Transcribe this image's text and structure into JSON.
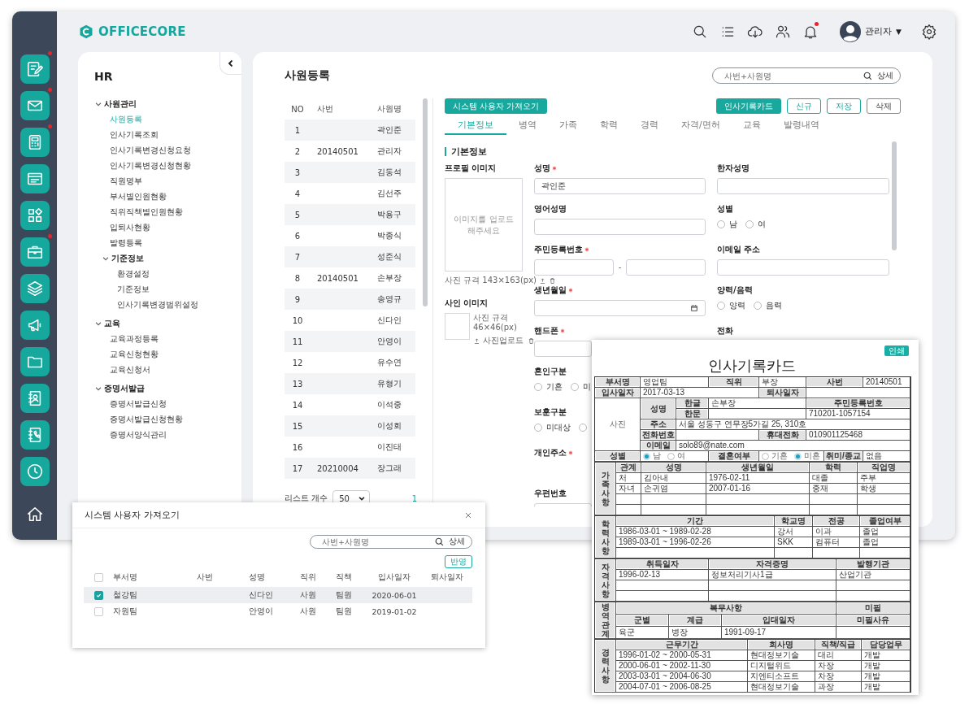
{
  "brand": {
    "name": "OFFICECORE"
  },
  "rail": {
    "items": [
      {
        "badge": true
      },
      {
        "badge": true
      },
      {
        "badge": true
      },
      {
        "badge": false
      },
      {
        "badge": false
      },
      {
        "badge": true
      },
      {
        "badge": false
      },
      {
        "badge": false
      },
      {
        "badge": false
      },
      {
        "badge": false
      },
      {
        "badge": false
      },
      {
        "badge": false
      }
    ]
  },
  "header": {
    "notification_badge": true,
    "user_name": "관리자",
    "user_caret": "▼"
  },
  "sidebar": {
    "title": "HR",
    "tree": [
      {
        "kind": "group",
        "label": "사원관리",
        "expanded": true,
        "children": [
          {
            "kind": "leaf",
            "label": "사원등록",
            "selected": true
          },
          {
            "kind": "leaf",
            "label": "인사기록조회",
            "selected": false
          },
          {
            "kind": "leaf",
            "label": "인사기록변경신청요청",
            "selected": false
          },
          {
            "kind": "leaf",
            "label": "인사기록변경신청현황",
            "selected": false
          },
          {
            "kind": "leaf",
            "label": "직원명부",
            "selected": false
          },
          {
            "kind": "leaf",
            "label": "부서별인원현황",
            "selected": false
          },
          {
            "kind": "leaf",
            "label": "직위직책별인원현황",
            "selected": false
          },
          {
            "kind": "leaf",
            "label": "입퇴사현황",
            "selected": false
          },
          {
            "kind": "leaf",
            "label": "발령등록",
            "selected": false
          },
          {
            "kind": "group",
            "label": "기준정보",
            "expanded": true,
            "children": [
              {
                "kind": "leaf",
                "label": "환경설정",
                "selected": false
              },
              {
                "kind": "leaf",
                "label": "기준정보",
                "selected": false
              },
              {
                "kind": "leaf",
                "label": "인사기록변경범위설정",
                "selected": false
              }
            ]
          }
        ]
      },
      {
        "kind": "group",
        "label": "교육",
        "expanded": true,
        "children": [
          {
            "kind": "leaf",
            "label": "교육과정등록",
            "selected": false
          },
          {
            "kind": "leaf",
            "label": "교육신청현황",
            "selected": false
          },
          {
            "kind": "leaf",
            "label": "교육신청서",
            "selected": false
          }
        ]
      },
      {
        "kind": "group",
        "label": "증명서발급",
        "expanded": true,
        "children": [
          {
            "kind": "leaf",
            "label": "증명서발급신청",
            "selected": false
          },
          {
            "kind": "leaf",
            "label": "증명서발급신청현황",
            "selected": false
          },
          {
            "kind": "leaf",
            "label": "증명서양식관리",
            "selected": false
          }
        ]
      }
    ]
  },
  "page": {
    "title": "사원등록",
    "search": {
      "placeholder": "사번+사원명",
      "detail_button": "상세"
    }
  },
  "employee_list": {
    "columns": [
      "NO",
      "사번",
      "사원명"
    ],
    "rows": [
      {
        "no": "1",
        "name": "곽인준"
      },
      {
        "no": "2",
        "id": "20140501",
        "name": "관리자"
      },
      {
        "no": "3",
        "name": "김동석"
      },
      {
        "no": "4",
        "name": "김선주"
      },
      {
        "no": "5",
        "name": "박용구"
      },
      {
        "no": "6",
        "name": "박종식"
      },
      {
        "no": "7",
        "name": "성준식"
      },
      {
        "no": "8",
        "id": "20140501",
        "name": "손부장"
      },
      {
        "no": "9",
        "name": "송영규"
      },
      {
        "no": "10",
        "name": "신다인"
      },
      {
        "no": "11",
        "name": "안영이"
      },
      {
        "no": "12",
        "name": "유수연"
      },
      {
        "no": "13",
        "name": "유형기"
      },
      {
        "no": "14",
        "name": "이석중"
      },
      {
        "no": "15",
        "name": "이성회"
      },
      {
        "no": "16",
        "name": "이진태"
      },
      {
        "no": "17",
        "id": "20210004",
        "name": "장그래"
      }
    ],
    "footer": {
      "label": "리스트 개수",
      "page_size": "50",
      "page": "1"
    }
  },
  "form": {
    "buttons": [
      {
        "label": "시스템 사용자 가져오기",
        "kind": "primary"
      },
      {
        "label": "인사기록카드",
        "kind": "primary"
      },
      {
        "label": "신규",
        "kind": "outline"
      },
      {
        "label": "저장",
        "kind": "outline"
      },
      {
        "label": "삭제",
        "kind": "plain"
      }
    ],
    "tabs": [
      {
        "label": "기본정보",
        "selected": true
      },
      {
        "label": "병역",
        "selected": false
      },
      {
        "label": "가족",
        "selected": false
      },
      {
        "label": "학력",
        "selected": false
      },
      {
        "label": "경력",
        "selected": false
      },
      {
        "label": "자격/면허",
        "selected": false
      },
      {
        "label": "교육",
        "selected": false
      },
      {
        "label": "발령내역",
        "selected": false
      }
    ],
    "section_title": "기본정보",
    "profile": {
      "label": "프로필 이미지",
      "upload_hint": "이미지를 업로드해주세요",
      "spec": "사진 규격 143×163(px)"
    },
    "sign": {
      "label": "사인 이미지",
      "spec": "사진 규격 46×46(px)",
      "upload": "사진업로드"
    },
    "fields": [
      {
        "kind": "text",
        "label": "성명",
        "required": true,
        "value": "곽인준"
      },
      {
        "kind": "text",
        "label": "한자성명",
        "required": false
      },
      {
        "kind": "text",
        "label": "영어성명",
        "required": false
      },
      {
        "kind": "radio",
        "label": "성별",
        "required": false,
        "options": [
          {
            "label": "남",
            "selected": false
          },
          {
            "label": "여",
            "selected": false
          }
        ]
      },
      {
        "kind": "split",
        "label": "주민등록번호",
        "required": true,
        "separator": "-"
      },
      {
        "kind": "text",
        "label": "이메일 주소",
        "required": false
      },
      {
        "kind": "date",
        "label": "생년월일",
        "required": true
      },
      {
        "kind": "radio",
        "label": "양력/음력",
        "required": false,
        "options": [
          {
            "label": "양력",
            "selected": false
          },
          {
            "label": "음력",
            "selected": false
          }
        ]
      },
      {
        "kind": "text",
        "label": "핸드폰",
        "required": true
      },
      {
        "kind": "label",
        "label": "전화",
        "required": false
      }
    ],
    "more_fields": [
      {
        "kind": "radio",
        "label": "혼인구분",
        "required": false,
        "options": [
          {
            "label": "기혼",
            "selected": false
          },
          {
            "label": "미",
            "selected": false
          }
        ]
      },
      {
        "kind": "radio",
        "label": "보훈구분",
        "required": false,
        "options": [
          {
            "label": "미대상",
            "selected": false
          },
          {
            "selected": false
          }
        ]
      },
      {
        "kind": "label",
        "label": "개인주소",
        "required": true
      },
      {
        "kind": "text",
        "label": "우편번호",
        "required": false
      }
    ]
  },
  "import_dialog": {
    "title": "시스템 사용자 가져오기",
    "search": {
      "placeholder": "사번+사원명",
      "detail_button": "상세"
    },
    "apply_button": "반영",
    "columns": [
      "부서명",
      "사번",
      "성명",
      "직위",
      "직책",
      "입사일자",
      "퇴사일자"
    ],
    "header_checked": false,
    "rows": [
      {
        "checked": true,
        "selected": true,
        "dept": "철강팀",
        "name": "신다인",
        "position": "사원",
        "role": "팀원",
        "joined": "2020-06-01"
      },
      {
        "checked": false,
        "selected": false,
        "dept": "자원팀",
        "name": "안영이",
        "position": "사원",
        "role": "팀원",
        "joined": "2019-01-02"
      }
    ]
  },
  "record_card": {
    "print_button": "인쇄",
    "title": "인사기록카드",
    "basic": {
      "cells": [
        {
          "kind": "head",
          "text": "부서명"
        },
        {
          "kind": "value",
          "text": "영업팀"
        },
        {
          "kind": "head",
          "text": "직위"
        },
        {
          "kind": "value",
          "text": "부장"
        },
        {
          "kind": "head",
          "text": "사번"
        },
        {
          "kind": "value",
          "text": "20140501"
        },
        {
          "kind": "head",
          "text": "입사일자"
        },
        {
          "kind": "value",
          "text": "2017-03-13"
        },
        {
          "kind": "head",
          "text": "퇴사일자"
        },
        {
          "kind": "photo",
          "text": "사진"
        },
        {
          "kind": "head",
          "text": "성명"
        },
        {
          "kind": "head",
          "text": "한글"
        },
        {
          "kind": "value",
          "text": "손부장"
        },
        {
          "kind": "head",
          "text": "주민등록번호"
        },
        {
          "kind": "head",
          "text": "한문"
        },
        {
          "kind": "value",
          "text": "710201-1057154"
        },
        {
          "kind": "head",
          "text": "주소"
        },
        {
          "kind": "value",
          "text": "서울 성동구 연무장5가길 25, 310호"
        },
        {
          "kind": "head",
          "text": "전화번호"
        },
        {
          "kind": "head",
          "text": "휴대전화"
        },
        {
          "kind": "value",
          "text": "010901125468"
        },
        {
          "kind": "head",
          "text": "이메일"
        },
        {
          "kind": "value",
          "text": "solo89@nate.com"
        },
        {
          "kind": "head",
          "text": "성별"
        },
        {
          "kind": "head",
          "text": "결혼여부"
        },
        {
          "kind": "head",
          "text": "취미/종교"
        },
        {
          "kind": "value",
          "text": "없음"
        }
      ],
      "gender": [
        {
          "label": "남",
          "selected": true
        },
        {
          "label": "여",
          "selected": false
        }
      ],
      "marital": [
        {
          "label": "기혼",
          "selected": false
        },
        {
          "label": "미혼",
          "selected": true
        }
      ]
    },
    "sections": [
      {
        "kind": "family",
        "label": "가족사항",
        "headers": [
          [
            "관계",
            "성명",
            "생년월일",
            "학력",
            "직업명"
          ]
        ],
        "rows": [
          [
            "처",
            "김아내",
            "1976-02-11",
            "대졸",
            "주부"
          ],
          [
            "자녀",
            "손귀염",
            "2007-01-16",
            "중재",
            "학생"
          ]
        ]
      },
      {
        "kind": "education",
        "label": "학력사항",
        "headers": [
          [
            "기간",
            "학교명",
            "전공",
            "졸업여부"
          ]
        ],
        "rows": [
          [
            "1986-03-01 ~ 1989-02-28",
            "강서",
            "이과",
            "졸업"
          ],
          [
            "1989-03-01 ~ 1996-02-26",
            "SKK",
            "컴퓨터",
            "졸업"
          ]
        ]
      },
      {
        "kind": "license",
        "label": "자격사항",
        "headers": [
          [
            "취득일자",
            "자격증명",
            "발행기관"
          ]
        ],
        "rows": [
          [
            "1996-02-13",
            "정보처리기사1급",
            "산업기관"
          ]
        ]
      },
      {
        "kind": "military",
        "label": "병역관계",
        "headers": [
          [
            "복무사항",
            "미필"
          ],
          [
            "군별",
            "계급",
            "입대일자",
            "미필사유"
          ]
        ],
        "rows": [
          [
            "육군",
            "병장",
            "1991-09-17"
          ]
        ]
      },
      {
        "kind": "career",
        "label": "경력사항",
        "headers": [
          [
            "근무기간",
            "회사명",
            "직책/직급",
            "담당업무"
          ]
        ],
        "rows": [
          [
            "1996-01-02 ~ 2000-05-31",
            "현대정보기술",
            "대리",
            "개발"
          ],
          [
            "2000-06-01 ~ 2002-11-30",
            "디지털위드",
            "차장",
            "개발"
          ],
          [
            "2003-03-01 ~ 2004-06-30",
            "지엔티소프트",
            "차장",
            "개발"
          ],
          [
            "2004-07-01 ~ 2006-08-25",
            "현대정보기술",
            "과장",
            "개발"
          ]
        ]
      }
    ]
  }
}
